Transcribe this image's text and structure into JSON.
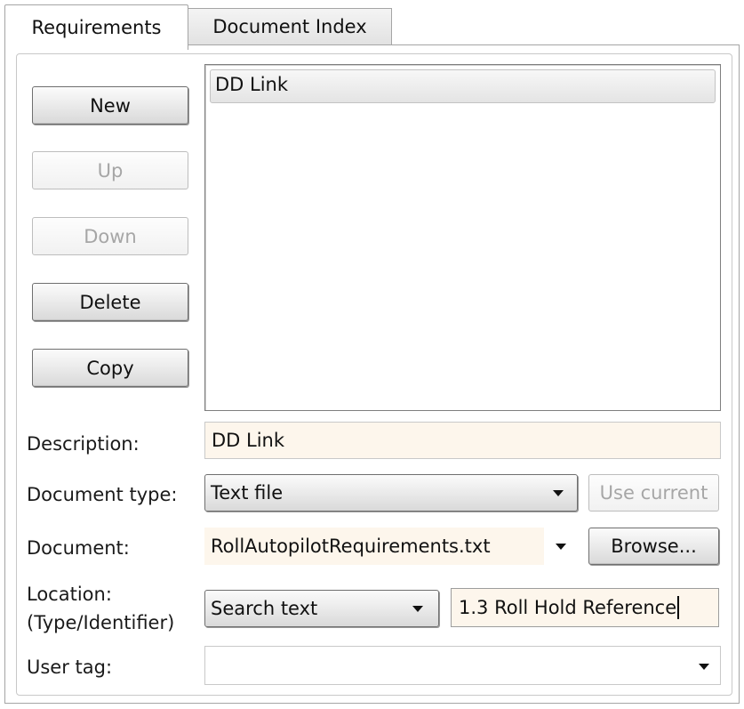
{
  "tabs": [
    {
      "label": "Requirements",
      "active": true
    },
    {
      "label": "Document Index",
      "active": false
    }
  ],
  "buttons": {
    "new": "New",
    "up": "Up",
    "down": "Down",
    "delete": "Delete",
    "copy": "Copy"
  },
  "list": {
    "items": [
      "DD Link"
    ]
  },
  "form": {
    "description_label": "Description:",
    "description_value": "DD Link",
    "doctype_label": "Document type:",
    "doctype_value": "Text file",
    "use_current": "Use current",
    "document_label": "Document:",
    "document_value": "RollAutopilotRequirements.txt",
    "browse": "Browse...",
    "location_label_1": "Location:",
    "location_label_2": "(Type/Identifier)",
    "location_type": "Search text",
    "location_identifier": "1.3 Roll Hold Reference",
    "usertag_label": "User tag:",
    "usertag_value": ""
  },
  "icons": {
    "dropdown": "chevron-down-icon"
  },
  "colors": {
    "field_bg": "#fdf6ec",
    "border": "#a5a5a5"
  }
}
